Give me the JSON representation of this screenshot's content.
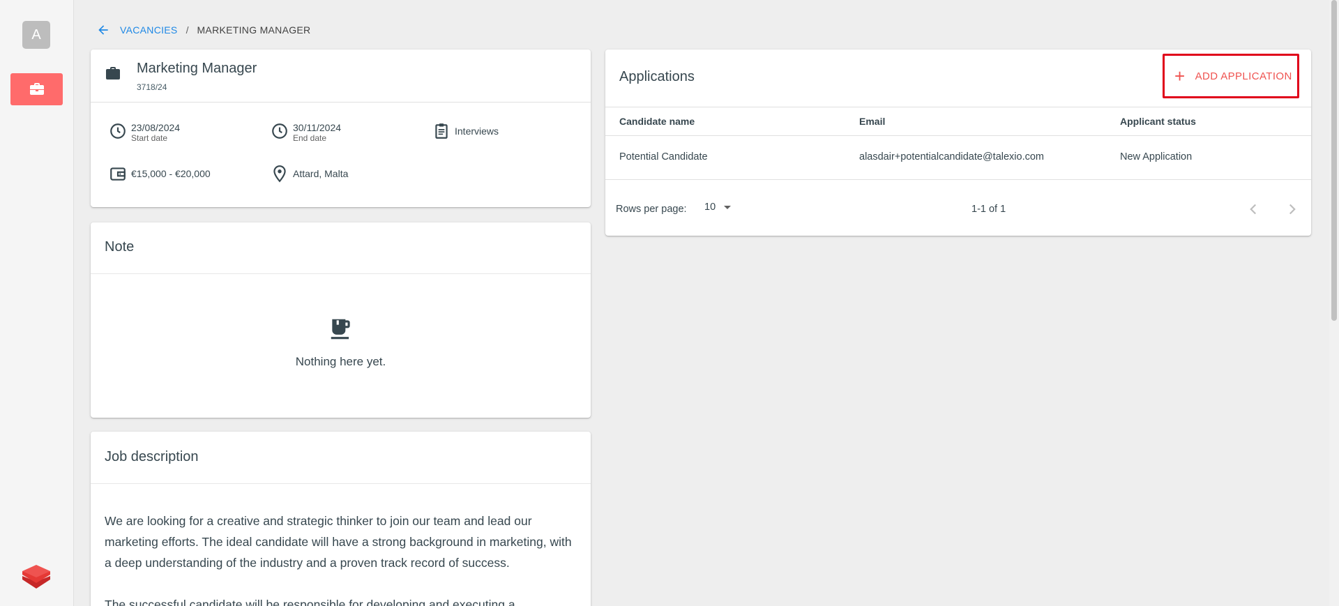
{
  "sidebar": {
    "avatar_letter": "A",
    "nav_icon": "briefcase-icon",
    "logo_icon": "stack-layers-icon",
    "accent": "#ff6b6b"
  },
  "breadcrumb": {
    "back_icon": "arrow-left-icon",
    "parent": "VACANCIES",
    "separator": "/",
    "current": "MARKETING MANAGER"
  },
  "job": {
    "title": "Marketing Manager",
    "code": "3718/24",
    "start_date": "23/08/2024",
    "start_label": "Start date",
    "end_date": "30/11/2024",
    "end_label": "End date",
    "stage": "Interviews",
    "salary": "€15,000 - €20,000",
    "location": "Attard, Malta"
  },
  "note": {
    "title": "Note",
    "empty_text": "Nothing here yet.",
    "empty_icon": "coffee-cup-icon"
  },
  "description": {
    "title": "Job description",
    "paragraphs": [
      "We are looking for a creative and strategic thinker to join our team and lead our marketing efforts. The ideal candidate will have a strong background in marketing, with a deep understanding of the industry and a proven track record of success.",
      "The successful candidate will be responsible for developing and executing a"
    ]
  },
  "applications": {
    "title": "Applications",
    "add_label": "ADD APPLICATION",
    "columns": [
      "Candidate name",
      "Email",
      "Applicant status"
    ],
    "rows": [
      [
        "Potential Candidate",
        "alasdair+potentialcandidate@talexio.com",
        "New Application"
      ]
    ],
    "rows_per_page_label": "Rows per page:",
    "rows_per_page": "10",
    "range": "1-1 of 1",
    "highlight_color": "#e0001a"
  }
}
